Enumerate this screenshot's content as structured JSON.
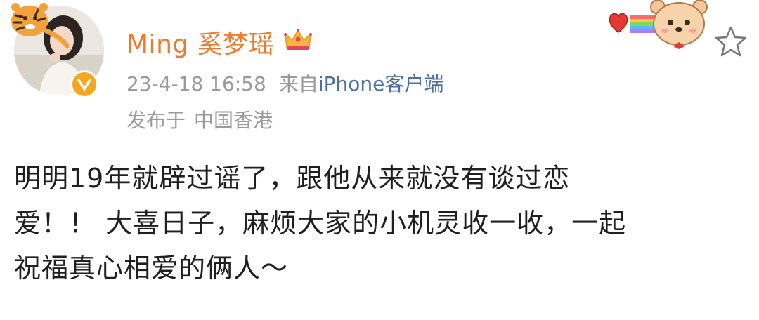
{
  "post": {
    "author": {
      "name": "Ming 奚梦瑶",
      "verified": true,
      "badge_color": "#f5a623"
    },
    "time": "23-4-18 16:58",
    "source_prefix": "来自",
    "source_app": "iPhone客户端",
    "location_prefix": "发布于",
    "location": "中国香港",
    "content_lines": [
      "明明19年就辟过谣了，跟他从来就没有谈过恋",
      "爱！！ 大喜日子，麻烦大家的小机灵收一收，一起",
      "祝福真心相爱的俩人～"
    ]
  },
  "colors": {
    "username": "#f07a2b",
    "meta": "#9a9a9a",
    "source_link": "#4a6fa5",
    "body_text": "#1f1f1f"
  },
  "icons": {
    "crown": "crown-icon",
    "verified": "verified-icon",
    "star": "star-icon",
    "decoration": "bear-heart-decoration"
  }
}
